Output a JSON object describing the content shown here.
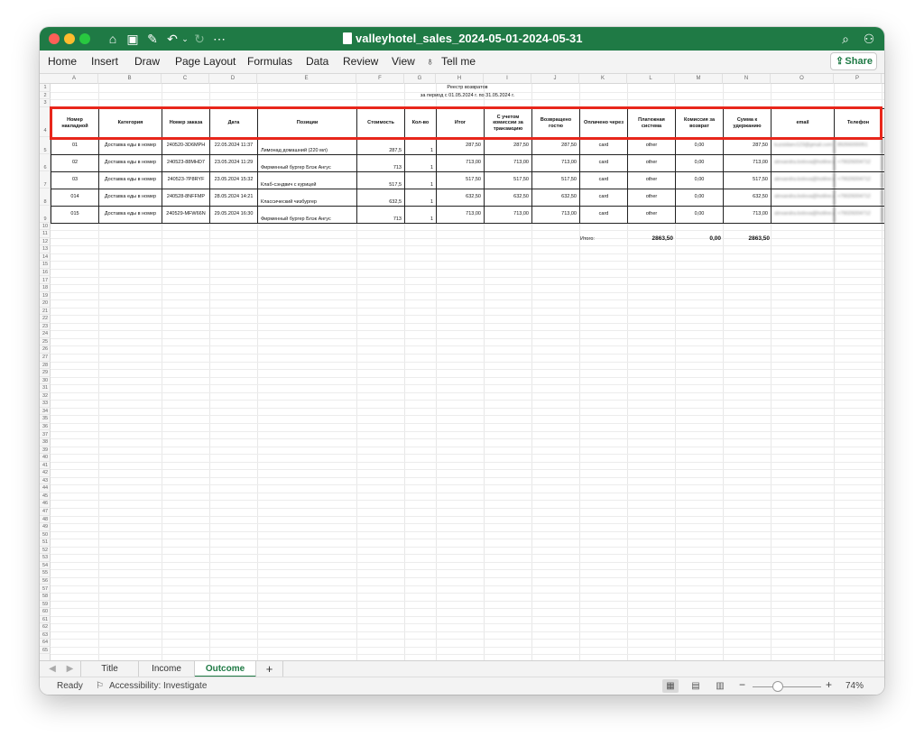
{
  "window": {
    "title": "valleyhotel_sales_2024-05-01-2024-05-31",
    "menu": [
      "Home",
      "Insert",
      "Draw",
      "Page Layout",
      "Formulas",
      "Data",
      "Review",
      "View",
      "Tell me"
    ],
    "share_label": "Share"
  },
  "columns": [
    "A",
    "B",
    "C",
    "D",
    "E",
    "F",
    "G",
    "H",
    "I",
    "J",
    "K",
    "L",
    "M",
    "N",
    "O",
    "P"
  ],
  "report": {
    "title": "Реестр возвратов",
    "subtitle": "за период с 01.05.2024 г. по 31.05.2024 г."
  },
  "table": {
    "headers": [
      "Номер накладной",
      "Категория",
      "Номер заказа",
      "Дата",
      "Позиции",
      "Стоимость",
      "Кол-во",
      "Итог",
      "С учетом комиссии за транзакцию",
      "Возвращено гостю",
      "Оплачено через",
      "Платежная система",
      "Комиссия за возврат",
      "Сумма к удержанию",
      "email",
      "Телефон"
    ],
    "rows": [
      {
        "num": "01",
        "cat": "Доставка еды в номер",
        "order": "240520-3D6MPH",
        "date": "22.05.2024 11:37",
        "item": "Лимонад домашний (220 мл)",
        "cost": "287,5",
        "qty": "1",
        "total": "287,50",
        "with_fee": "287,50",
        "returned": "287,50",
        "paid": "card",
        "system": "other",
        "fee": "0,00",
        "hold": "287,50",
        "email": "kuzsidaev123@gmail.com",
        "phone": "89266000051"
      },
      {
        "num": "02",
        "cat": "Доставка еды в номер",
        "order": "240523-88MHD7",
        "date": "23.05.2024 11:29",
        "item": "Фирменный бургер Блэк Ангус",
        "cost": "713",
        "qty": "1",
        "total": "713,00",
        "with_fee": "713,00",
        "returned": "713,00",
        "paid": "card",
        "system": "other",
        "fee": "0,00",
        "hold": "713,00",
        "email": "alexandra.bolova@hotline.ru",
        "phone": "+79026004712"
      },
      {
        "num": "03",
        "cat": "Доставка еды в номер",
        "order": "240523-7P8RYF",
        "date": "23.05.2024 15:32",
        "item": "Клаб-сэндвич с курицей",
        "cost": "517,5",
        "qty": "1",
        "total": "517,50",
        "with_fee": "517,50",
        "returned": "517,50",
        "paid": "card",
        "system": "other",
        "fee": "0,00",
        "hold": "517,50",
        "email": "alexandra.bolova@hotline.ru",
        "phone": "+79026004712"
      },
      {
        "num": "014",
        "cat": "Доставка еды в номер",
        "order": "240528-8NFFMP",
        "date": "28.05.2024 14:21",
        "item": "Классический чизбургер",
        "cost": "632,5",
        "qty": "1",
        "total": "632,50",
        "with_fee": "632,50",
        "returned": "632,50",
        "paid": "card",
        "system": "other",
        "fee": "0,00",
        "hold": "632,50",
        "email": "alexandra.bolova@hotline.ru",
        "phone": "+79026004712"
      },
      {
        "num": "015",
        "cat": "Доставка еды в номер",
        "order": "240529-MFW66N",
        "date": "29.05.2024 16:30",
        "item": "Фирменный бургер Блэк Ангус",
        "cost": "713",
        "qty": "1",
        "total": "713,00",
        "with_fee": "713,00",
        "returned": "713,00",
        "paid": "card",
        "system": "other",
        "fee": "0,00",
        "hold": "713,00",
        "email": "alexandra.bolova@hotline.ru",
        "phone": "+79026004712"
      }
    ],
    "totals": {
      "label": "Итого:",
      "returned": "2863,50",
      "fee": "0,00",
      "hold": "2863,50"
    }
  },
  "tabs": [
    "Title",
    "Income",
    "Outcome"
  ],
  "active_tab": "Outcome",
  "status": {
    "ready": "Ready",
    "accessibility": "Accessibility: Investigate",
    "zoom": "74%"
  },
  "colors": {
    "brand": "#1f7a45",
    "highlight": "#e8261b"
  }
}
